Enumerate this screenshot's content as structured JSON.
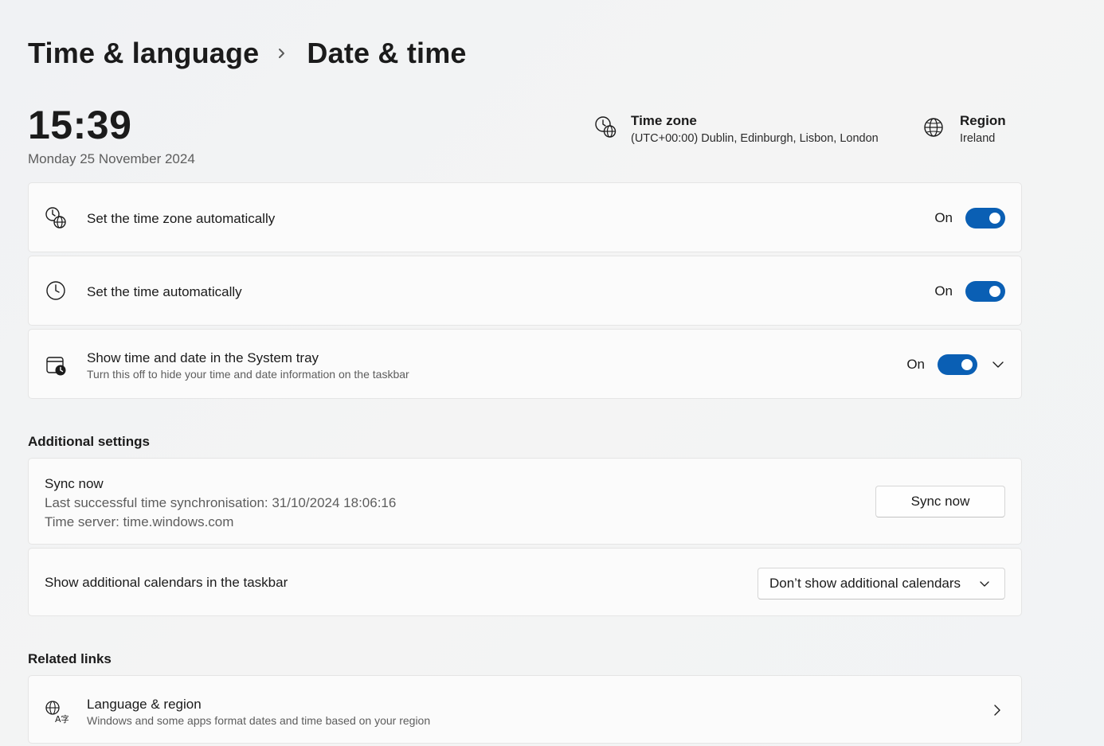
{
  "breadcrumb": {
    "parent": "Time & language",
    "current": "Date & time"
  },
  "clock": {
    "time": "15:39",
    "date": "Monday 25 November 2024"
  },
  "time_zone_info": {
    "title": "Time zone",
    "value": "(UTC+00:00) Dublin, Edinburgh, Lisbon, London"
  },
  "region_info": {
    "title": "Region",
    "value": "Ireland"
  },
  "settings": {
    "auto_timezone": {
      "label": "Set the time zone automatically",
      "state": "On"
    },
    "auto_time": {
      "label": "Set the time automatically",
      "state": "On"
    },
    "system_tray": {
      "label": "Show time and date in the System tray",
      "description": "Turn this off to hide your time and date information on the taskbar",
      "state": "On"
    }
  },
  "additional_settings": {
    "heading": "Additional settings",
    "sync": {
      "title": "Sync now",
      "last_sync": "Last successful time synchronisation: 31/10/2024 18:06:16",
      "server": "Time server: time.windows.com",
      "button_label": "Sync now"
    },
    "calendars": {
      "label": "Show additional calendars in the taskbar",
      "selected": "Don’t show additional calendars"
    }
  },
  "related_links": {
    "heading": "Related links",
    "language_region": {
      "title": "Language & region",
      "description": "Windows and some apps format dates and time based on your region"
    }
  },
  "colors": {
    "accent": "#0a5fb4",
    "card_bg": "#fbfbfb",
    "page_bg": "#f3f3f3"
  }
}
